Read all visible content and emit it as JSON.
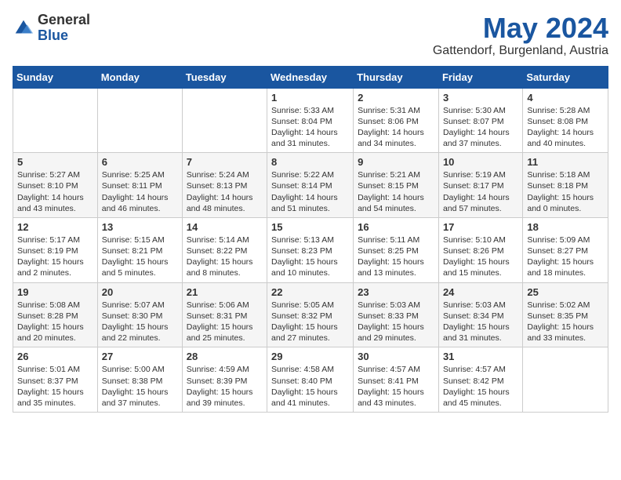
{
  "header": {
    "logo_general": "General",
    "logo_blue": "Blue",
    "title": "May 2024",
    "location": "Gattendorf, Burgenland, Austria"
  },
  "weekdays": [
    "Sunday",
    "Monday",
    "Tuesday",
    "Wednesday",
    "Thursday",
    "Friday",
    "Saturday"
  ],
  "weeks": [
    [
      {
        "day": "",
        "info": ""
      },
      {
        "day": "",
        "info": ""
      },
      {
        "day": "",
        "info": ""
      },
      {
        "day": "1",
        "info": "Sunrise: 5:33 AM\nSunset: 8:04 PM\nDaylight: 14 hours\nand 31 minutes."
      },
      {
        "day": "2",
        "info": "Sunrise: 5:31 AM\nSunset: 8:06 PM\nDaylight: 14 hours\nand 34 minutes."
      },
      {
        "day": "3",
        "info": "Sunrise: 5:30 AM\nSunset: 8:07 PM\nDaylight: 14 hours\nand 37 minutes."
      },
      {
        "day": "4",
        "info": "Sunrise: 5:28 AM\nSunset: 8:08 PM\nDaylight: 14 hours\nand 40 minutes."
      }
    ],
    [
      {
        "day": "5",
        "info": "Sunrise: 5:27 AM\nSunset: 8:10 PM\nDaylight: 14 hours\nand 43 minutes."
      },
      {
        "day": "6",
        "info": "Sunrise: 5:25 AM\nSunset: 8:11 PM\nDaylight: 14 hours\nand 46 minutes."
      },
      {
        "day": "7",
        "info": "Sunrise: 5:24 AM\nSunset: 8:13 PM\nDaylight: 14 hours\nand 48 minutes."
      },
      {
        "day": "8",
        "info": "Sunrise: 5:22 AM\nSunset: 8:14 PM\nDaylight: 14 hours\nand 51 minutes."
      },
      {
        "day": "9",
        "info": "Sunrise: 5:21 AM\nSunset: 8:15 PM\nDaylight: 14 hours\nand 54 minutes."
      },
      {
        "day": "10",
        "info": "Sunrise: 5:19 AM\nSunset: 8:17 PM\nDaylight: 14 hours\nand 57 minutes."
      },
      {
        "day": "11",
        "info": "Sunrise: 5:18 AM\nSunset: 8:18 PM\nDaylight: 15 hours\nand 0 minutes."
      }
    ],
    [
      {
        "day": "12",
        "info": "Sunrise: 5:17 AM\nSunset: 8:19 PM\nDaylight: 15 hours\nand 2 minutes."
      },
      {
        "day": "13",
        "info": "Sunrise: 5:15 AM\nSunset: 8:21 PM\nDaylight: 15 hours\nand 5 minutes."
      },
      {
        "day": "14",
        "info": "Sunrise: 5:14 AM\nSunset: 8:22 PM\nDaylight: 15 hours\nand 8 minutes."
      },
      {
        "day": "15",
        "info": "Sunrise: 5:13 AM\nSunset: 8:23 PM\nDaylight: 15 hours\nand 10 minutes."
      },
      {
        "day": "16",
        "info": "Sunrise: 5:11 AM\nSunset: 8:25 PM\nDaylight: 15 hours\nand 13 minutes."
      },
      {
        "day": "17",
        "info": "Sunrise: 5:10 AM\nSunset: 8:26 PM\nDaylight: 15 hours\nand 15 minutes."
      },
      {
        "day": "18",
        "info": "Sunrise: 5:09 AM\nSunset: 8:27 PM\nDaylight: 15 hours\nand 18 minutes."
      }
    ],
    [
      {
        "day": "19",
        "info": "Sunrise: 5:08 AM\nSunset: 8:28 PM\nDaylight: 15 hours\nand 20 minutes."
      },
      {
        "day": "20",
        "info": "Sunrise: 5:07 AM\nSunset: 8:30 PM\nDaylight: 15 hours\nand 22 minutes."
      },
      {
        "day": "21",
        "info": "Sunrise: 5:06 AM\nSunset: 8:31 PM\nDaylight: 15 hours\nand 25 minutes."
      },
      {
        "day": "22",
        "info": "Sunrise: 5:05 AM\nSunset: 8:32 PM\nDaylight: 15 hours\nand 27 minutes."
      },
      {
        "day": "23",
        "info": "Sunrise: 5:03 AM\nSunset: 8:33 PM\nDaylight: 15 hours\nand 29 minutes."
      },
      {
        "day": "24",
        "info": "Sunrise: 5:03 AM\nSunset: 8:34 PM\nDaylight: 15 hours\nand 31 minutes."
      },
      {
        "day": "25",
        "info": "Sunrise: 5:02 AM\nSunset: 8:35 PM\nDaylight: 15 hours\nand 33 minutes."
      }
    ],
    [
      {
        "day": "26",
        "info": "Sunrise: 5:01 AM\nSunset: 8:37 PM\nDaylight: 15 hours\nand 35 minutes."
      },
      {
        "day": "27",
        "info": "Sunrise: 5:00 AM\nSunset: 8:38 PM\nDaylight: 15 hours\nand 37 minutes."
      },
      {
        "day": "28",
        "info": "Sunrise: 4:59 AM\nSunset: 8:39 PM\nDaylight: 15 hours\nand 39 minutes."
      },
      {
        "day": "29",
        "info": "Sunrise: 4:58 AM\nSunset: 8:40 PM\nDaylight: 15 hours\nand 41 minutes."
      },
      {
        "day": "30",
        "info": "Sunrise: 4:57 AM\nSunset: 8:41 PM\nDaylight: 15 hours\nand 43 minutes."
      },
      {
        "day": "31",
        "info": "Sunrise: 4:57 AM\nSunset: 8:42 PM\nDaylight: 15 hours\nand 45 minutes."
      },
      {
        "day": "",
        "info": ""
      }
    ]
  ]
}
